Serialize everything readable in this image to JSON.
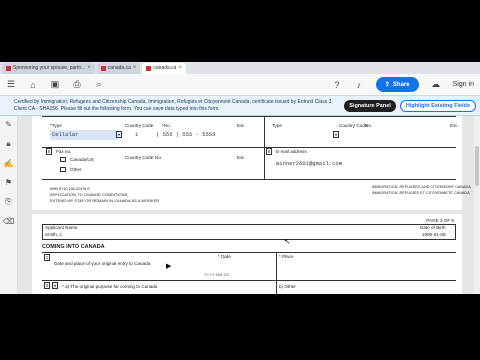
{
  "header": {
    "signin_label": "Sign I"
  },
  "browser": {
    "tabs": [
      {
        "label": "Sponsoring your spouse, partn...",
        "active": false
      },
      {
        "label": "canada.ca",
        "active": false
      },
      {
        "label": "canada.ca",
        "active": true
      }
    ]
  },
  "toolbar": {
    "share_label": "Share",
    "signin_label": "Sign in"
  },
  "notification": {
    "text": "Certified by Immigration, Refugees and Citizenship Canada, Immigration, Refugiés et Citoyenneté Canada, certificate issued by Entrust Class 3 Client CA - SHA256.  Please fill out the following form. You can save data typed into this form.",
    "signature_panel_label": "Signature Panel",
    "highlight_label": "Highlight Existing Fields"
  },
  "page1": {
    "type_label_1": "*Type",
    "country_code_label_1": "Country Code",
    "no_label_1": "*No.",
    "ext_label_1": "Ext.",
    "type_value_1": "Cellular",
    "country_code_value_1": "1",
    "phone_value_1": "( 555 ) 555 - 5555",
    "type_label_2": "Type",
    "country_code_label_2": "Country Code",
    "no_label_2": "No.",
    "ext_label_2": "Ext.",
    "section5_num": "5",
    "fax_label": "Fax no.",
    "canada_us_label": "Canada/US",
    "other_label": "Other",
    "country_code_label_3": "Country Code",
    "no_label_3": "No.",
    "ext_label_3": "Ext.",
    "section6_num": "6",
    "email_label": "E-mail address",
    "email_value": "Winner2601@gmail.com",
    "form_code": "IMM 5710 (06-2019) E",
    "footer_left_1": "APPLICATION TO CHANGE CONDITIONS,",
    "footer_left_2": "EXTEND MY STAY OR REMAIN IN CANADA AS A WORKER",
    "footer_right_1": "IMMIGRATION, REFUGEES AND CITIZENSHIP CANADA",
    "footer_right_2": "IMMIGRATION, RÉFUGIÉS ET CITOYENNETÉ CANADA"
  },
  "page2": {
    "page_label": "PAGE 3 OF 5",
    "applicant_name_label": "Applicant Name",
    "applicant_name_value": "Smith, J.",
    "dob_label": "Date of Birth",
    "dob_value": "1990-01-05",
    "section_title": "COMING INTO CANADA",
    "q1_num": "1",
    "q1_label": "Date and place of your original entry to Canada",
    "date_label": "* Date",
    "date_placeholder": "YYYY-MM-DD",
    "place_label": "* Place",
    "q2_num": "2",
    "q2_label": "* a) The original purpose for coming to Canada",
    "q2_other_label": "b) Other"
  },
  "colors": {
    "accent": "#1473e6",
    "notification_bg": "#e8f2fb"
  }
}
